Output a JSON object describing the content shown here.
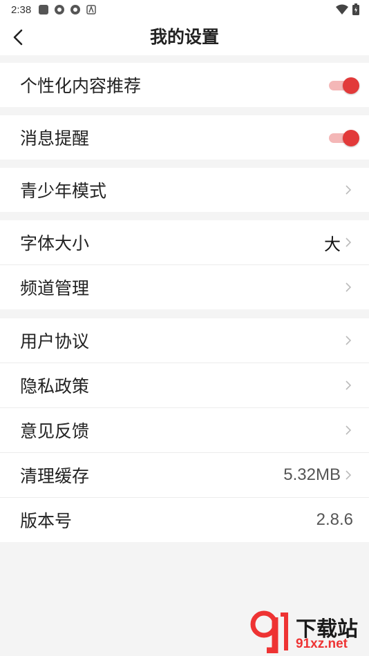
{
  "status_bar": {
    "time": "2:38",
    "battery_icon": "battery-icon",
    "wifi_icon": "wifi-icon"
  },
  "header": {
    "title": "我的设置",
    "back_icon": "back-arrow-icon"
  },
  "groups": [
    {
      "rows": [
        {
          "label": "个性化内容推荐",
          "type": "toggle",
          "on": true
        }
      ]
    },
    {
      "rows": [
        {
          "label": "消息提醒",
          "type": "toggle",
          "on": true
        }
      ]
    },
    {
      "rows": [
        {
          "label": "青少年模式",
          "type": "nav"
        }
      ]
    },
    {
      "rows": [
        {
          "label": "字体大小",
          "type": "nav",
          "value": "大"
        },
        {
          "label": "频道管理",
          "type": "nav"
        }
      ]
    },
    {
      "rows": [
        {
          "label": "用户协议",
          "type": "nav"
        },
        {
          "label": "隐私政策",
          "type": "nav"
        },
        {
          "label": "意见反馈",
          "type": "nav"
        },
        {
          "label": "清理缓存",
          "type": "nav",
          "value": "5.32MB"
        },
        {
          "label": "版本号",
          "type": "info",
          "value": "2.8.6"
        }
      ]
    }
  ],
  "watermark": {
    "text": "下载站",
    "url": "91xz.net"
  },
  "colors": {
    "accent": "#e23a3a",
    "toggle_track": "#f4b7b7",
    "background": "#f4f4f4"
  }
}
